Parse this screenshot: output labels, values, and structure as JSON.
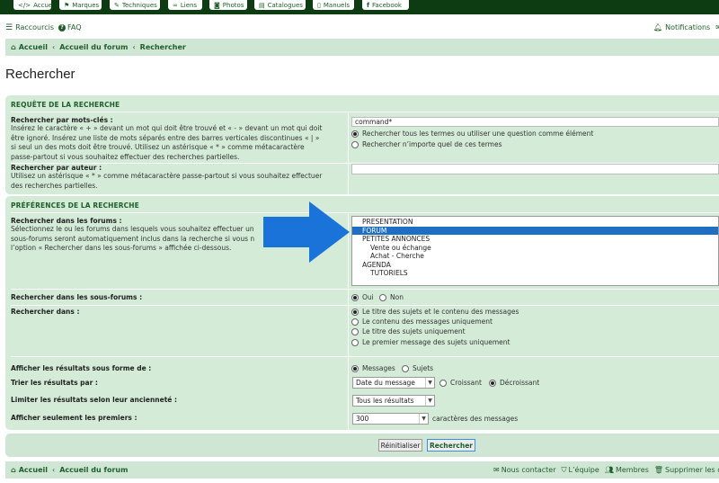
{
  "topnav": {
    "items": [
      {
        "label": "Accueil",
        "icon": "code-icon"
      },
      {
        "label": "Marques",
        "icon": "tag-icon"
      },
      {
        "label": "Techniques",
        "icon": "wrench-icon"
      },
      {
        "label": "Liens",
        "icon": "link-icon"
      },
      {
        "label": "Photos",
        "icon": "camera-icon"
      },
      {
        "label": "Catalogues",
        "icon": "book-icon"
      },
      {
        "label": "Manuels",
        "icon": "document-icon"
      },
      {
        "label": "Facebook",
        "icon": "facebook-icon"
      }
    ]
  },
  "quicklinks": {
    "shortcuts": "Raccourcis",
    "faq": "FAQ",
    "notifications": "Notifications"
  },
  "breadcrumb": {
    "home": "Accueil",
    "forum_index": "Accueil du forum",
    "current": "Rechercher"
  },
  "page_title": "Rechercher",
  "query_section": {
    "heading": "REQUÊTE DE LA RECHERCHE",
    "keywords_label": "Rechercher par mots-clés :",
    "keywords_help": [
      "Insérez le caractère « + » devant un mot qui doit être trouvé et « - » devant un mot qui doit",
      "être ignoré. Insérez une liste de mots séparés entre des barres verticales discontinues « | »",
      "si seul un des mots doit être trouvé. Utilisez un astérisque « * » comme métacaractère",
      "passe-partout si vous souhaitez effectuer des recherches partielles."
    ],
    "keywords_value": "command*",
    "terms_all": "Rechercher tous les termes ou utiliser une question comme élément",
    "terms_any": "Rechercher n’importe quel de ces termes",
    "author_label": "Rechercher par auteur :",
    "author_help": [
      "Utilisez un astérisque « * » comme métacaractère passe-partout si vous souhaitez effectuer",
      "des recherches partielles."
    ],
    "author_value": ""
  },
  "prefs_section": {
    "heading": "PRÉFÉRENCES DE LA RECHERCHE",
    "forums_label": "Rechercher dans les forums :",
    "forums_help": [
      "Sélectionnez le ou les forums dans lesquels vous souhaitez effectuer un",
      "sous-forums seront automatiquement inclus dans la recherche si vous n",
      "l’option « Rechercher dans les sous-forums » affichée ci-dessous."
    ],
    "forum_options": [
      {
        "label": "PRESENTATION",
        "indent": 1,
        "selected": false
      },
      {
        "label": "FORUM",
        "indent": 1,
        "selected": true
      },
      {
        "label": "PETITES ANNONCES",
        "indent": 1,
        "selected": false
      },
      {
        "label": "Vente ou échange",
        "indent": 2,
        "selected": false
      },
      {
        "label": "Achat - Cherche",
        "indent": 2,
        "selected": false
      },
      {
        "label": "AGENDA",
        "indent": 1,
        "selected": false
      },
      {
        "label": "TUTORIELS",
        "indent": 2,
        "selected": false
      }
    ],
    "subforums_label": "Rechercher dans les sous-forums :",
    "yes": "Oui",
    "no": "Non",
    "search_in_label": "Rechercher dans :",
    "search_in_options": [
      "Le titre des sujets et le contenu des messages",
      "Le contenu des messages uniquement",
      "Le titre des sujets uniquement",
      "Le premier message des sujets uniquement"
    ],
    "display_label": "Afficher les résultats sous forme de :",
    "display_posts": "Messages",
    "display_topics": "Sujets",
    "sort_label": "Trier les résultats par :",
    "sort_value": "Date du message",
    "ascending": "Croissant",
    "descending": "Décroissant",
    "limit_label": "Limiter les résultats selon leur ancienneté :",
    "limit_value": "Tous les résultats",
    "first_label": "Afficher seulement les premiers :",
    "first_value": "300",
    "chars_suffix": "caractères des messages"
  },
  "actions": {
    "reset": "Réinitialiser",
    "search": "Rechercher"
  },
  "footer": {
    "home": "Accueil",
    "forum_index": "Accueil du forum",
    "contact": "Nous contacter",
    "team": "L’équipe",
    "members": "Membres",
    "delete_cookies": "Supprimer les coo"
  },
  "colors": {
    "dark_green": "#0d3b12",
    "panel": "#d4ebd8",
    "link": "#1f5e2a",
    "select_blue": "#1e6fc4",
    "arrow_blue": "#1a73d9"
  }
}
